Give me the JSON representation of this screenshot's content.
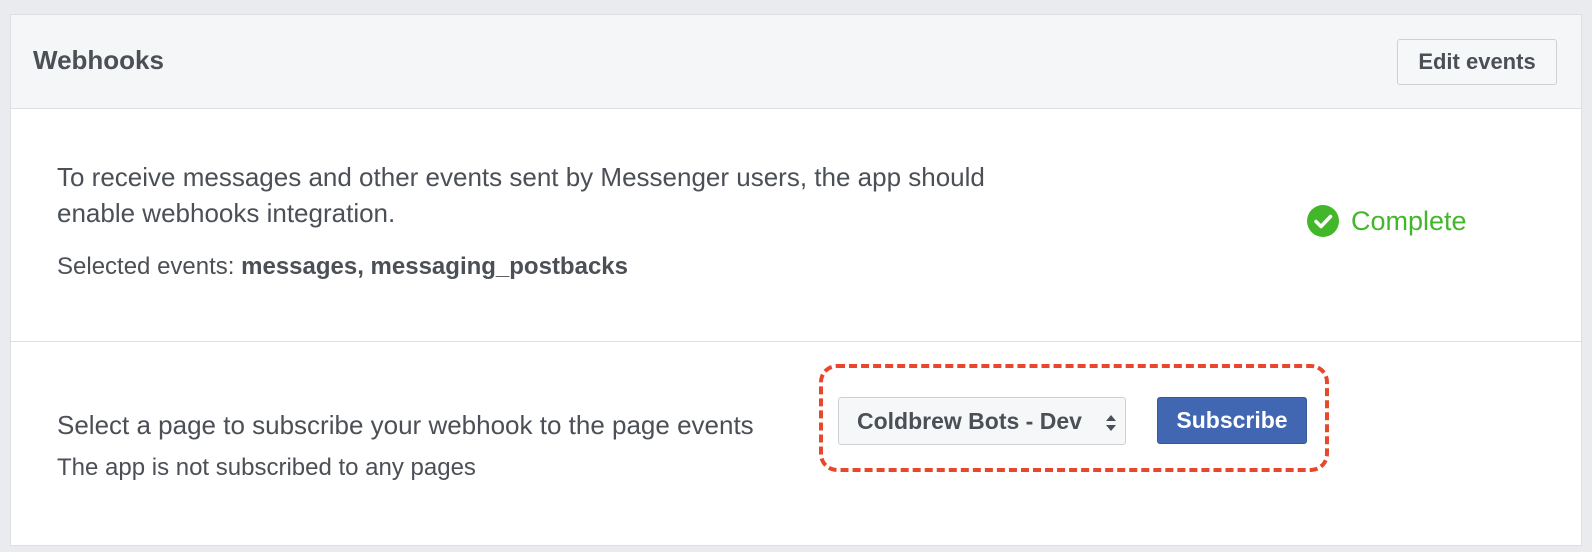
{
  "header": {
    "title": "Webhooks",
    "edit_events_label": "Edit events"
  },
  "intro": {
    "description": "To receive messages and other events sent by Messenger users, the app should enable webhooks integration.",
    "selected_events_label": "Selected events: ",
    "selected_events_value": "messages, messaging_postbacks",
    "status_label": "Complete"
  },
  "subscription": {
    "prompt": "Select a page to subscribe your webhook to the page events",
    "status": "The app is not subscribed to any pages",
    "page_select_value": "Coldbrew Bots - Dev",
    "subscribe_label": "Subscribe"
  },
  "colors": {
    "accent": "#4267b2",
    "success": "#42b72a",
    "highlight": "#e8472c"
  },
  "icons": {
    "status": "check-circle-icon",
    "select": "select-arrows-icon"
  }
}
